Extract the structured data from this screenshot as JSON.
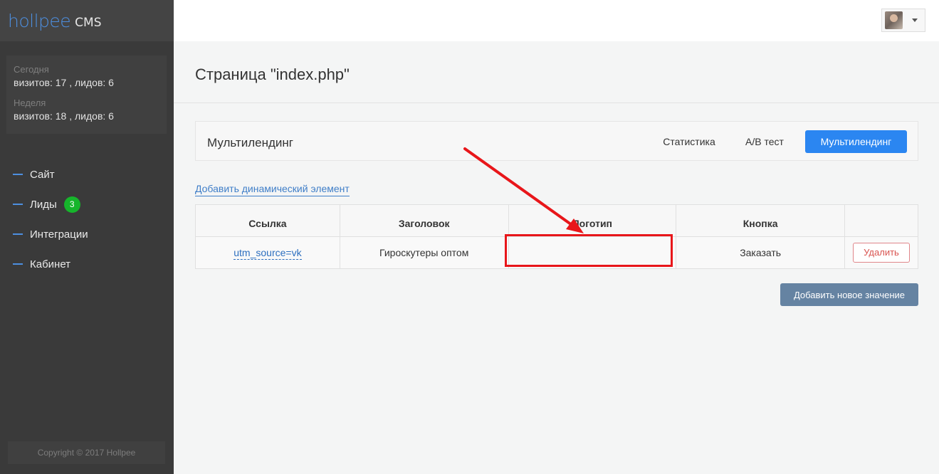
{
  "brand": {
    "logo": "hollpee",
    "suffix": "CMS"
  },
  "sidebar": {
    "stats": [
      {
        "label": "Сегодня",
        "value": "визитов: 17 , лидов: 6"
      },
      {
        "label": "Неделя",
        "value": "визитов: 18 , лидов: 6"
      }
    ],
    "nav": [
      {
        "label": "Сайт"
      },
      {
        "label": "Лиды",
        "badge": "3"
      },
      {
        "label": "Интеграции"
      },
      {
        "label": "Кабинет"
      }
    ],
    "copyright": "Copyright © 2017 Hollpee"
  },
  "page": {
    "title": "Страница \"index.php\""
  },
  "panel": {
    "title": "Мультилендинг",
    "tabs": [
      {
        "label": "Статистика",
        "active": false
      },
      {
        "label": "A/B тест",
        "active": false
      },
      {
        "label": "Мультилендинг",
        "active": true
      }
    ]
  },
  "add_dynamic_link": "Добавить динамический элемент",
  "table": {
    "headers": [
      "Ссылка",
      "Заголовок",
      "Логотип",
      "Кнопка",
      ""
    ],
    "rows": [
      {
        "link": "utm_source=vk",
        "title": "Гироскутеры оптом",
        "logo": "",
        "button": "Заказать",
        "delete": "Удалить"
      }
    ]
  },
  "add_value_button": "Добавить новое значение",
  "colors": {
    "sidebar_bg": "#3a3a3a",
    "accent": "#2b86f1",
    "badge": "#16b52b",
    "annotation": "#e8161a"
  }
}
